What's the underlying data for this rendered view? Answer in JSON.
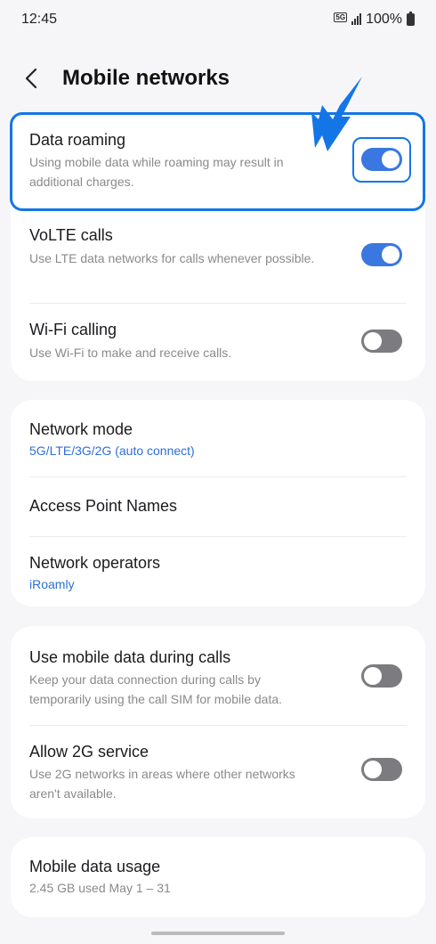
{
  "status_bar": {
    "time": "12:45",
    "network_badge": "5G",
    "battery": "100%",
    "icons": [
      "signal-icon",
      "battery-icon"
    ]
  },
  "header": {
    "back_icon": "chevron-left-icon",
    "title": "Mobile networks"
  },
  "group1": [
    {
      "title": "Data roaming",
      "subtitle": "Using mobile data while roaming may result in additional charges.",
      "toggle": "on"
    },
    {
      "title": "VoLTE calls",
      "subtitle": "Use LTE data networks for calls whenever possible.",
      "toggle": "on"
    },
    {
      "title": "Wi-Fi calling",
      "subtitle": "Use Wi-Fi to make and receive calls.",
      "toggle": "off"
    }
  ],
  "group2": [
    {
      "title": "Network mode",
      "subtitle": "5G/LTE/3G/2G (auto connect)"
    },
    {
      "title": "Access Point Names"
    },
    {
      "title": "Network operators",
      "subtitle": "iRoamly"
    }
  ],
  "group3": [
    {
      "title": "Use mobile data during calls",
      "subtitle": "Keep your data connection during calls by temporarily using the call SIM for mobile data.",
      "toggle": "off"
    },
    {
      "title": "Allow 2G service",
      "subtitle": "Use 2G networks in areas where other networks aren't available.",
      "toggle": "off"
    }
  ],
  "group4": [
    {
      "title": "Mobile data usage",
      "subtitle": "2.45 GB used May 1 – 31"
    }
  ],
  "colors": {
    "accent": "#3a77e0",
    "highlight": "#1476e6",
    "link": "#2d6fd6",
    "toggle_off": "#7c7c80"
  }
}
